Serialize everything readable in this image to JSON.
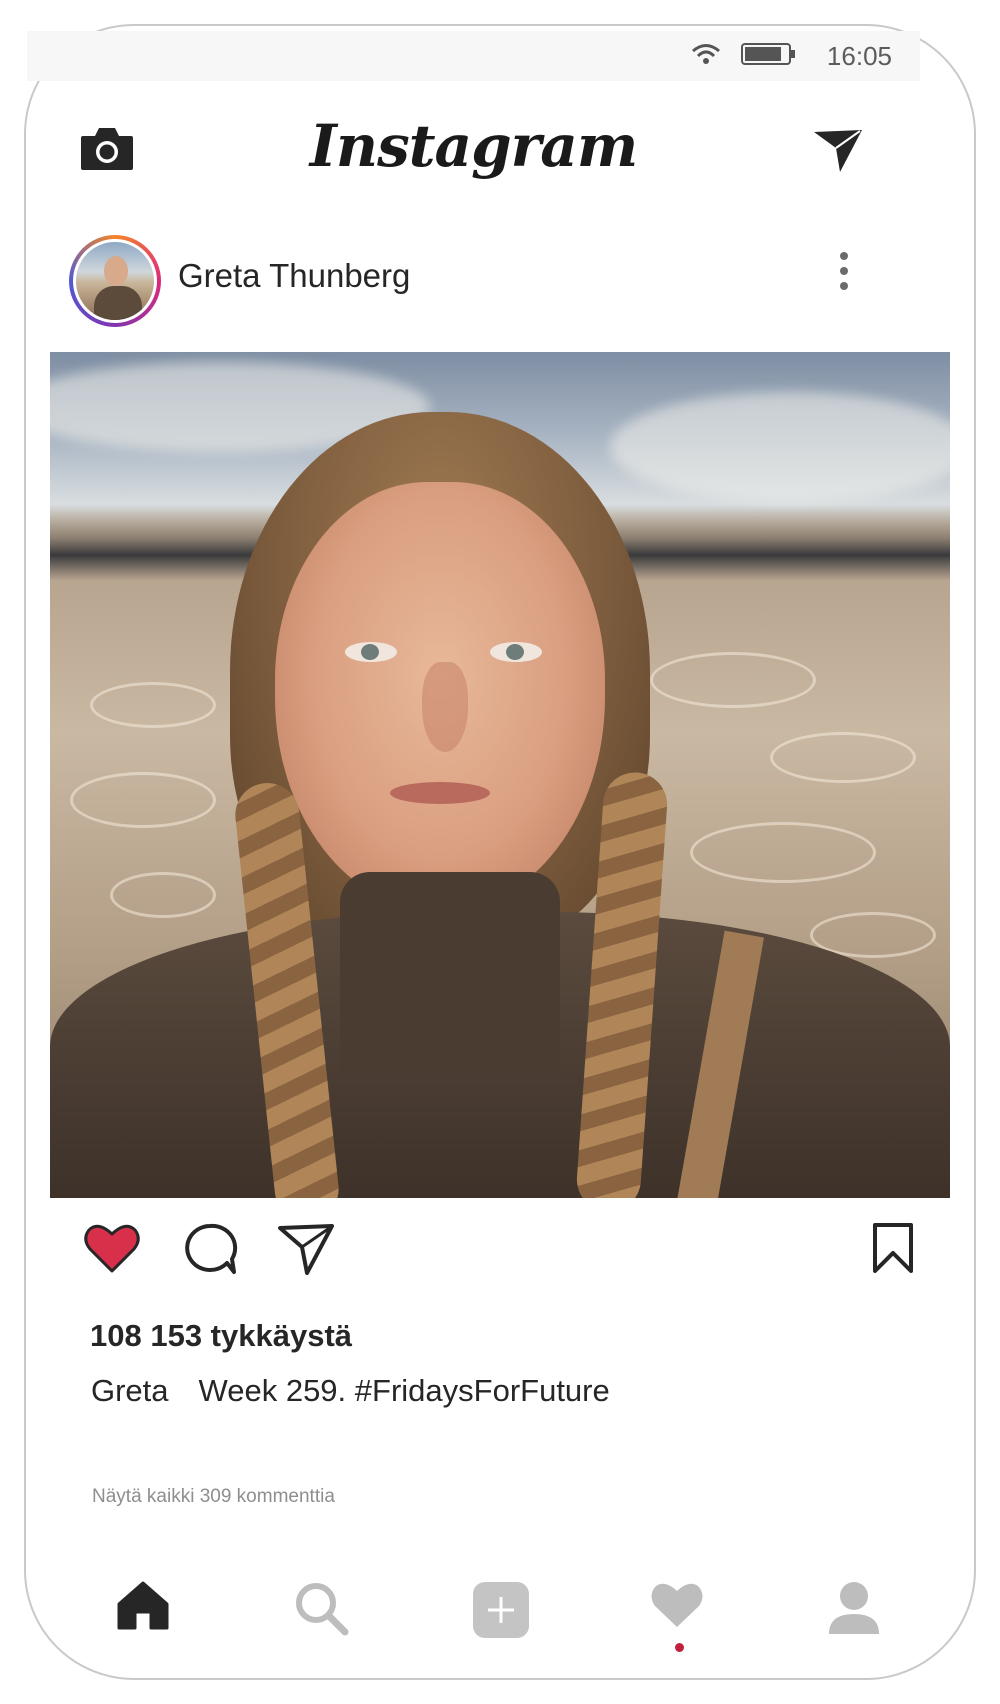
{
  "status_bar": {
    "time": "16:05",
    "icons": [
      "wifi-icon",
      "battery-icon"
    ]
  },
  "top_bar": {
    "logo_text": "Instagram",
    "left_icon": "camera-icon",
    "right_icon": "direct-send-icon"
  },
  "post": {
    "username": "Greta Thunberg",
    "image_alt": "Selfie of a young woman with braided hair on a dry cracked desert flat",
    "likes_text": "108 153 tykkäystä",
    "caption_user": "Greta",
    "caption_text": "Week 259. #FridaysForFuture",
    "view_comments": "Näytä kaikki 309 kommenttia",
    "liked": true
  },
  "actions": {
    "icons": [
      "heart-icon",
      "comment-icon",
      "share-icon",
      "bookmark-icon"
    ]
  },
  "bottom_nav": {
    "items": [
      "home-icon",
      "search-icon",
      "add-post-icon",
      "activity-icon",
      "profile-icon"
    ],
    "active": "home-icon"
  },
  "colors": {
    "like_red": "#d8304b",
    "notification_dot": "#c0203b",
    "muted_icon": "#bdbdbd",
    "text": "#262626",
    "subtle_text": "#8e8e8e"
  }
}
